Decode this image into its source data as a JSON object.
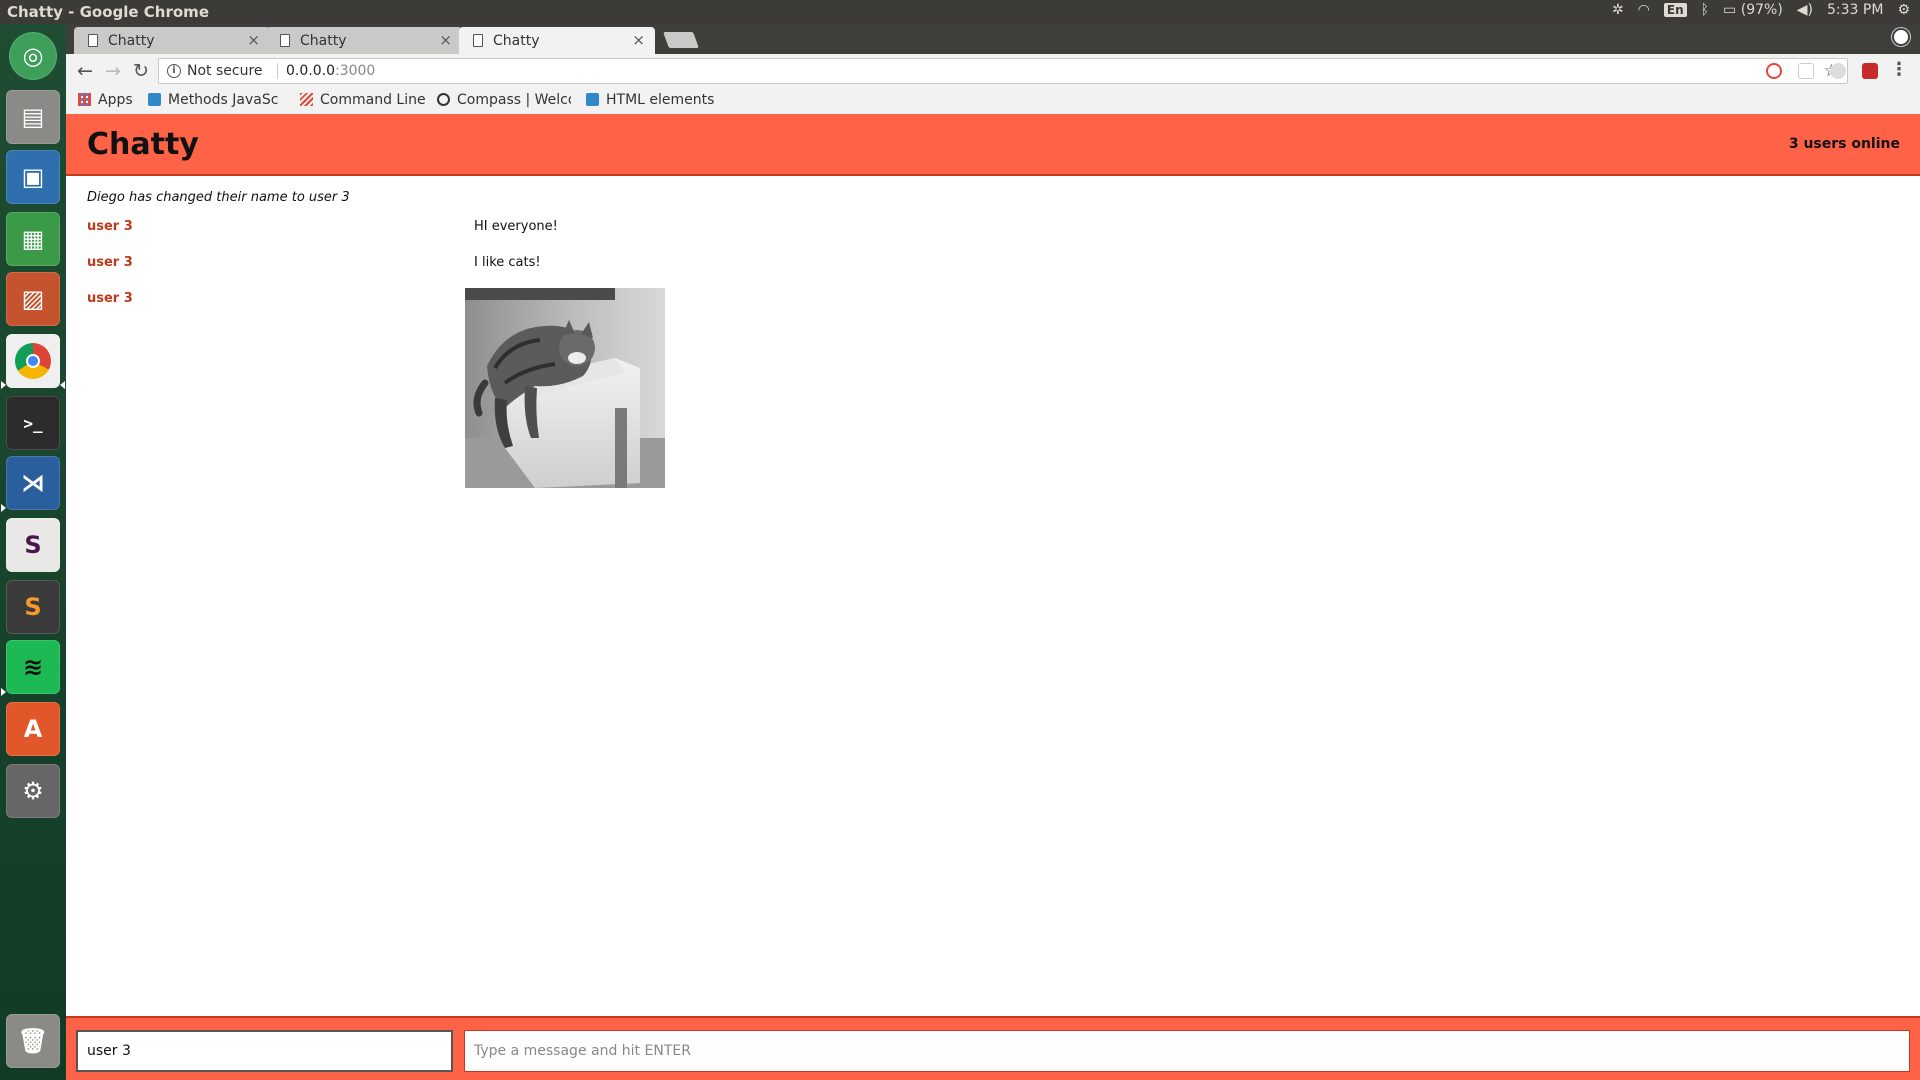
{
  "system": {
    "window_title": "Chatty - Google Chrome",
    "keyboard_layout": "En",
    "battery": "(97%)",
    "clock": "5:33 PM"
  },
  "browser": {
    "tabs": [
      {
        "label": "Chatty",
        "active": false
      },
      {
        "label": "Chatty",
        "active": false
      },
      {
        "label": "Chatty",
        "active": true
      }
    ],
    "address": {
      "security": "Not secure",
      "host": "0.0.0.0",
      "port": ":3000"
    },
    "bookmarks": [
      {
        "label": "Apps",
        "icon": "apps-grid-icon"
      },
      {
        "label": "Methods JavaSc",
        "icon": "bookmark-favicon-icon"
      },
      {
        "label": "Command Line",
        "icon": "bookmark-favicon-icon"
      },
      {
        "label": "Compass | Welco",
        "icon": "compass-favicon-icon"
      },
      {
        "label": "HTML elements",
        "icon": "bookmark-favicon-icon"
      }
    ]
  },
  "app": {
    "title": "Chatty",
    "users_online": "3 users online",
    "accent_color": "#ff6347",
    "username_color": "#c0391b"
  },
  "messages": {
    "system_notification": "Diego has changed their name to user 3",
    "items": [
      {
        "username": "user 3",
        "content": "HI everyone!"
      },
      {
        "username": "user 3",
        "content": "I like cats!"
      },
      {
        "username": "user 3",
        "content": "",
        "image": "cat-photo"
      }
    ]
  },
  "composer": {
    "username_value": "user 3",
    "message_placeholder": "Type a message and hit ENTER"
  }
}
